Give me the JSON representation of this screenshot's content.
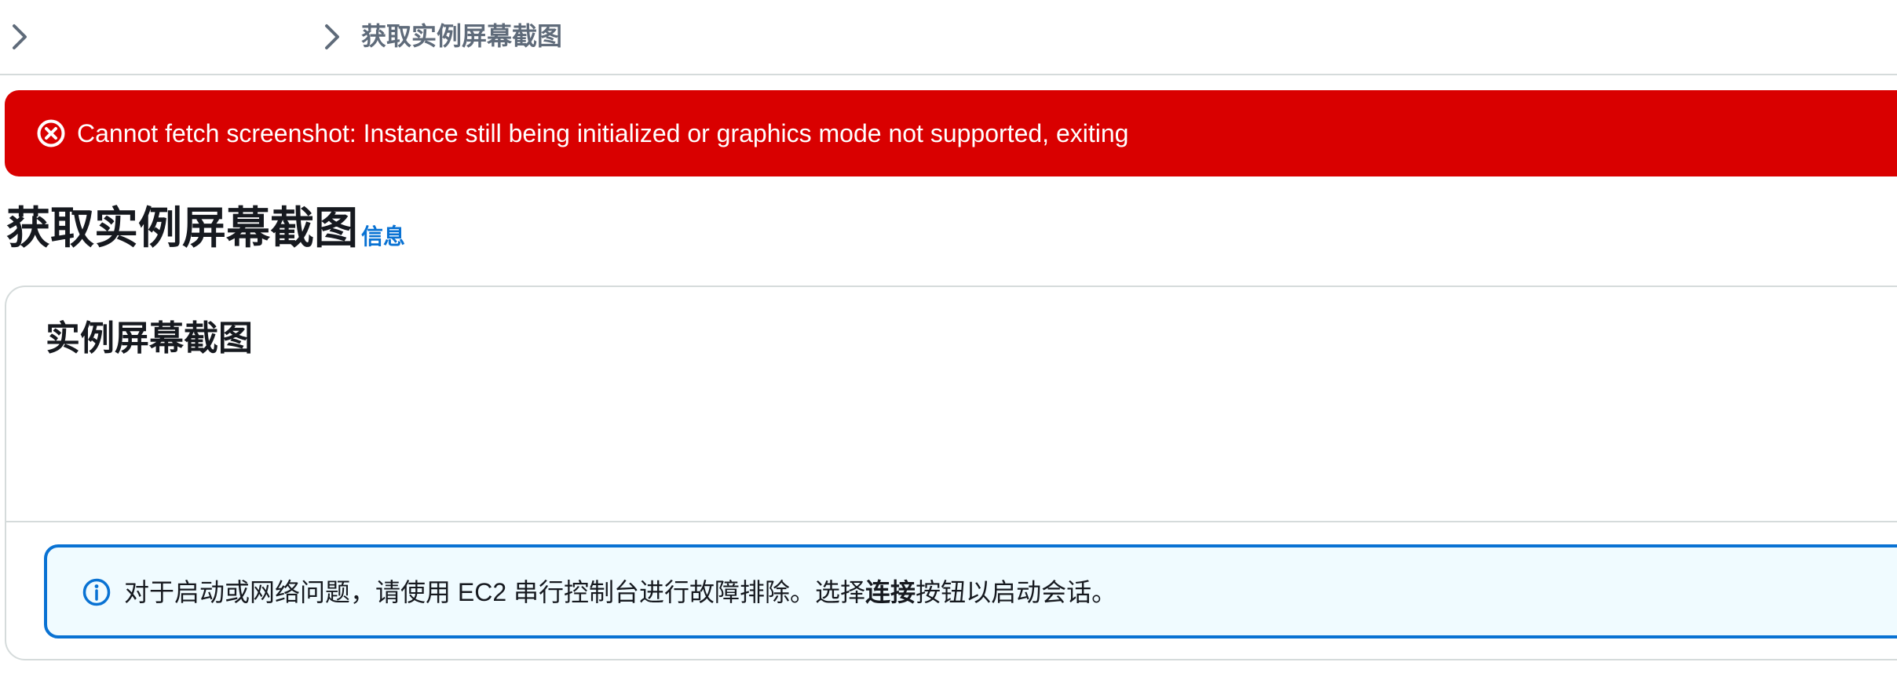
{
  "breadcrumb": {
    "current": "获取实例屏幕截图"
  },
  "error": {
    "icon": "error-circle-icon",
    "message": "Cannot fetch screenshot: Instance still being initialized or graphics mode not supported, exiting",
    "color": "#d90000"
  },
  "page": {
    "title": "获取实例屏幕截图",
    "info_link": "信息"
  },
  "panel": {
    "title": "实例屏幕截图"
  },
  "info_alert": {
    "icon": "info-circle-icon",
    "text_before": "对于启动或网络问题，请使用 EC2 串行控制台进行故障排除。选择",
    "text_bold": "连接",
    "text_after": "按钮以启动会话。",
    "color": "#0972d3"
  }
}
